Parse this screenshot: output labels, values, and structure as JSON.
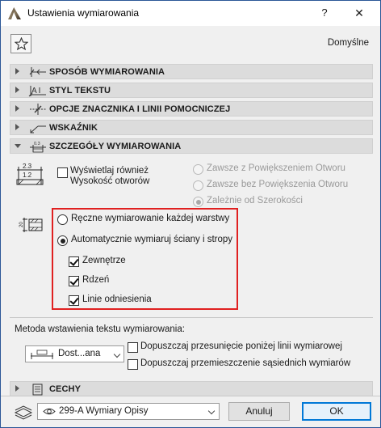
{
  "window": {
    "title": "Ustawienia wymiarowania",
    "help": "?",
    "close": "✕"
  },
  "header": {
    "favorites_icon": "star-icon",
    "preset": "Domyślne"
  },
  "sections": [
    {
      "label": "SPOSÓB WYMIAROWANIA",
      "expanded": false,
      "icon": "dimension-method-icon"
    },
    {
      "label": "STYL TEKSTU",
      "expanded": false,
      "icon": "text-style-icon"
    },
    {
      "label": "OPCJE ZNACZNIKA I LINII POMOCNICZEJ",
      "expanded": false,
      "icon": "marker-options-icon"
    },
    {
      "label": "WSKAŹNIK",
      "expanded": false,
      "icon": "pointer-icon"
    },
    {
      "label": "SZCZEGÓŁY WYMIAROWANIA",
      "expanded": true,
      "icon": "dimension-details-icon"
    }
  ],
  "details": {
    "icon_top": "2.3",
    "icon_bottom": "1.2",
    "show_opening_height": {
      "line1": "Wyświetlaj również",
      "line2": "Wysokość otworów",
      "checked": false
    },
    "opening_options": [
      {
        "label": "Zawsze z Powiększeniem Otworu",
        "selected": false,
        "enabled": false
      },
      {
        "label": "Zawsze bez Powiększenia Otworu",
        "selected": false,
        "enabled": false
      },
      {
        "label": "Zależnie od Szerokości",
        "selected": true,
        "enabled": false
      }
    ],
    "wall_icon_label": "20",
    "layer_mode": [
      {
        "label": "Ręczne wymiarowanie każdej warstwy",
        "selected": false
      },
      {
        "label": "Automatycznie wymiaruj ściany i stropy",
        "selected": true
      }
    ],
    "auto_options": [
      {
        "label": "Zewnętrze",
        "checked": true
      },
      {
        "label": "Rdzeń",
        "checked": true
      },
      {
        "label": "Linie odniesienia",
        "checked": true
      }
    ],
    "text_placement_label": "Metoda wstawienia tekstu wymiarowania:",
    "text_placement_value": "Dost...ana",
    "allow_offset": {
      "label": "Dopuszczaj przesunięcie poniżej linii wymiarowej",
      "checked": false
    },
    "allow_neighbor_move": {
      "label": "Dopuszczaj przemieszczenie sąsiednich wymiarów",
      "checked": false
    }
  },
  "cechy": {
    "label": "CECHY",
    "expanded": false,
    "icon": "properties-icon"
  },
  "footer": {
    "layer": "299-A Wymiary Opisy",
    "cancel": "Anuluj",
    "ok": "OK"
  },
  "colors": {
    "highlight_box": "#e02020",
    "section_bg": "#dcdcdc",
    "primary_border": "#0078d7"
  }
}
